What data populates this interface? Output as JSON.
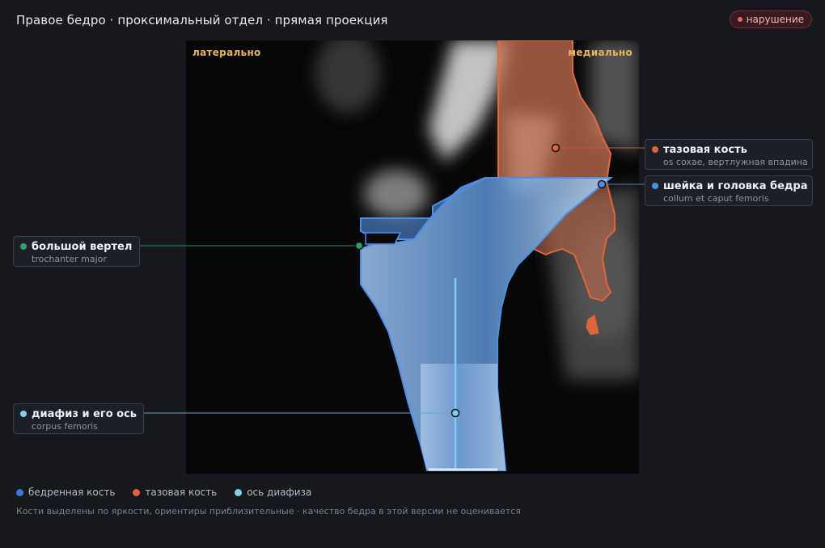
{
  "header": {
    "title": "Правое бедро · проксимальный отдел · прямая проекция",
    "badge": "нарушение"
  },
  "orientation": {
    "lateral": "латерально",
    "medial": "медиально"
  },
  "callouts": {
    "pelvis": {
      "title": "тазовая кость",
      "subtitle": "os coxae, вертлужная впадина",
      "color": "#e0643a"
    },
    "neck": {
      "title": "шейка и головка бедра",
      "subtitle": "collum et caput femoris",
      "color": "#4a8fe0"
    },
    "trochanter": {
      "title": "большой вертел",
      "subtitle": "trochanter major",
      "color": "#2aa06a"
    },
    "shaft": {
      "title": "диафиз и его ось",
      "subtitle": "corpus femoris",
      "color": "#7fd0f0"
    }
  },
  "legend": [
    {
      "label": "бедренная кость",
      "color": "#3a7bd5"
    },
    {
      "label": "тазовая кость",
      "color": "#e0643a"
    },
    {
      "label": "ось диафиза",
      "color": "#7fd0f0"
    }
  ],
  "footnote": "Кости выделены по яркости, ориентиры приблизительные · качество бедра в этой версии не оценивается",
  "colors": {
    "femur_fill": "#3a7bd5",
    "femur_stroke": "#4a8fe8",
    "pelvis_fill": "#d8643c",
    "pelvis_stroke": "#e0643a",
    "axis": "#7fd0f0",
    "badge_bg": "#3a1a1e"
  }
}
